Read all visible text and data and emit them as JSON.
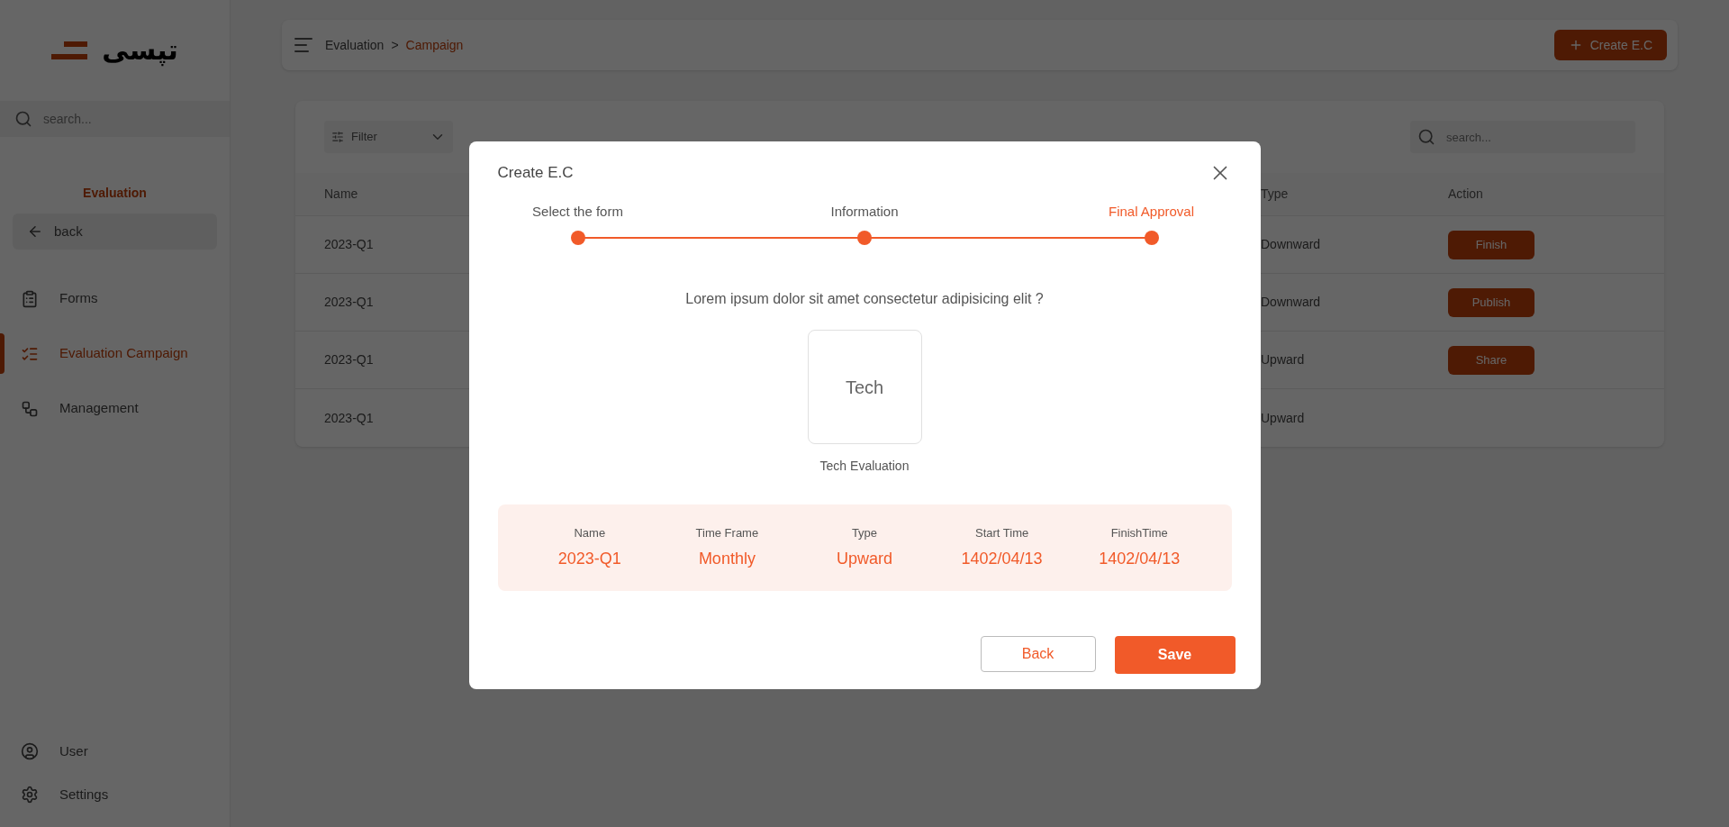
{
  "logo": {
    "text": "تپسی"
  },
  "sidebar": {
    "search_placeholder": "search...",
    "section_title": "Evaluation",
    "back_label": "back",
    "items": [
      {
        "label": "Forms",
        "selected": false
      },
      {
        "label": "Evaluation Campaign",
        "selected": true
      },
      {
        "label": "Management",
        "selected": false
      }
    ],
    "bottom_items": [
      {
        "label": "User"
      },
      {
        "label": "Settings"
      }
    ]
  },
  "header": {
    "breadcrumb": [
      {
        "label": "Evaluation",
        "selected": false
      },
      {
        "label": "Campaign",
        "selected": true
      }
    ],
    "separator": ">",
    "create_button": "Create E.C"
  },
  "toolbar": {
    "filter_label": "Filter",
    "search_placeholder": "search..."
  },
  "table": {
    "columns": [
      "Name",
      "Type",
      "Action"
    ],
    "rows": [
      {
        "name": "2023-Q1",
        "type": "Downward",
        "action": "Finish"
      },
      {
        "name": "2023-Q1",
        "type": "Downward",
        "action": "Publish"
      },
      {
        "name": "2023-Q1",
        "type": "Upward",
        "action": "Share"
      },
      {
        "name": "2023-Q1",
        "type": "Upward"
      }
    ]
  },
  "dialog": {
    "title": "Create E.C",
    "steps": [
      {
        "label": "Select the form",
        "selected": false
      },
      {
        "label": "Information",
        "selected": false
      },
      {
        "label": "Final Approval",
        "selected": true
      }
    ],
    "question": "Lorem ipsum dolor sit amet consectetur adipisicing elit ?",
    "form_card": {
      "text": "Tech",
      "caption": "Tech Evaluation"
    },
    "summary": [
      {
        "label": "Name",
        "value": "2023-Q1"
      },
      {
        "label": "Time Frame",
        "value": "Monthly"
      },
      {
        "label": "Type",
        "value": "Upward"
      },
      {
        "label": "Start Time",
        "value": "1402/04/13"
      },
      {
        "label": "FinishTime",
        "value": "1402/04/13"
      }
    ],
    "buttons": {
      "back": "Back",
      "save": "Save"
    }
  }
}
